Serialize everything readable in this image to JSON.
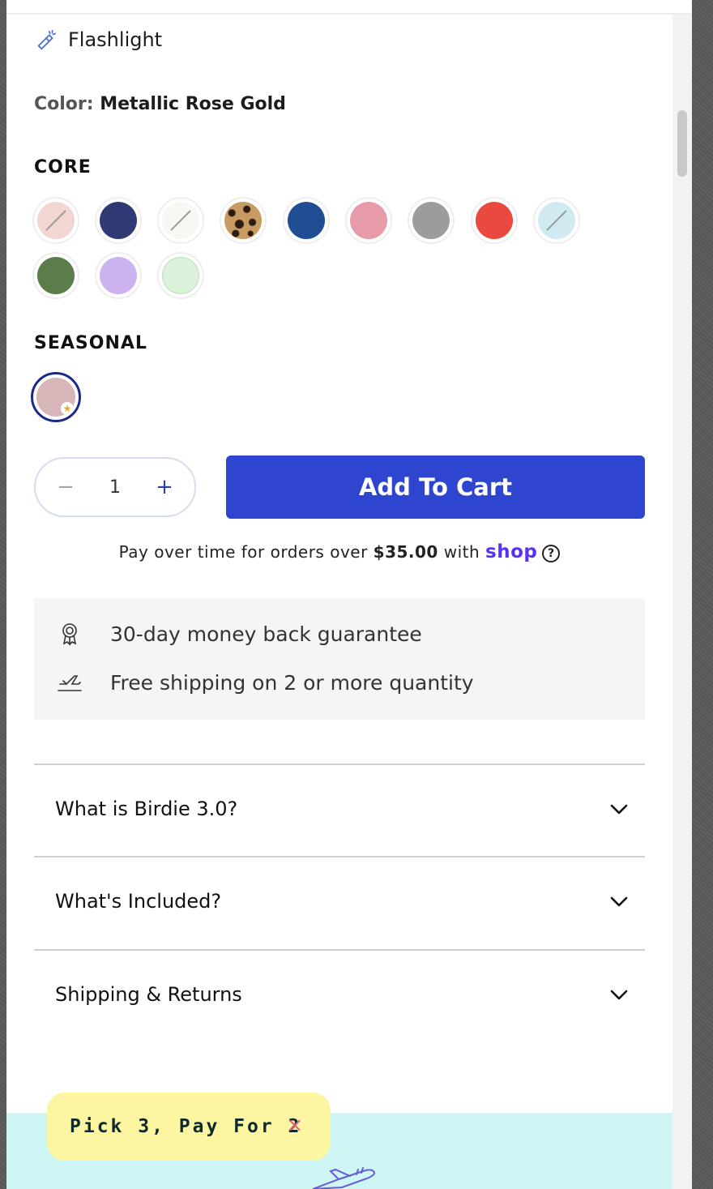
{
  "feature": {
    "label": "Flashlight",
    "icon": "flashlight-icon"
  },
  "color": {
    "key": "Color:",
    "value": "Metallic Rose Gold"
  },
  "sections": {
    "core_title": "CORE",
    "seasonal_title": "SEASONAL"
  },
  "core_swatches": [
    {
      "name": "blush-sold-out",
      "color": "#f1d6d1",
      "sold_out": true
    },
    {
      "name": "navy",
      "color": "#2f3a74",
      "sold_out": false
    },
    {
      "name": "white-sold-out",
      "color": "#f7f7f4",
      "sold_out": true
    },
    {
      "name": "leopard",
      "color": "#c99a62",
      "sold_out": false
    },
    {
      "name": "blue",
      "color": "#1f4e95",
      "sold_out": false
    },
    {
      "name": "pink",
      "color": "#e79aaa",
      "sold_out": false
    },
    {
      "name": "gray",
      "color": "#9c9c9c",
      "sold_out": false
    },
    {
      "name": "red",
      "color": "#e9493f",
      "sold_out": false
    },
    {
      "name": "light-blue-sold-out",
      "color": "#cfeaf0",
      "sold_out": true
    },
    {
      "name": "green",
      "color": "#5a7d4b",
      "sold_out": false
    },
    {
      "name": "lavender",
      "color": "#ccb2ef",
      "sold_out": false
    },
    {
      "name": "mint",
      "color": "#dbf1da",
      "sold_out": false
    }
  ],
  "seasonal_swatches": [
    {
      "name": "metallic-rose-gold",
      "color": "#d6b6b8",
      "selected": true,
      "badge": "★"
    }
  ],
  "quantity": {
    "minus": "−",
    "value": "1",
    "plus": "+"
  },
  "cart": {
    "add_label": "Add To Cart"
  },
  "pay": {
    "prefix": "Pay over time for orders over ",
    "amount": "$35.00",
    "middle": " with ",
    "brand": "shop",
    "help": "?"
  },
  "guarantees": [
    {
      "icon": "award-ribbon-icon",
      "text": "30-day money back guarantee"
    },
    {
      "icon": "airplane-icon",
      "text": "Free shipping on 2 or more quantity"
    }
  ],
  "accordions": [
    {
      "label": "What is Birdie 3.0?"
    },
    {
      "label": "What's Included?"
    },
    {
      "label": "Shipping & Returns"
    }
  ],
  "promo": {
    "text": "Pick 3, Pay For 2",
    "close": "×"
  },
  "colors": {
    "brand_blue": "#2d45cf",
    "promo_yellow": "#fcf6a2",
    "promo_band": "#cdf6f4"
  }
}
